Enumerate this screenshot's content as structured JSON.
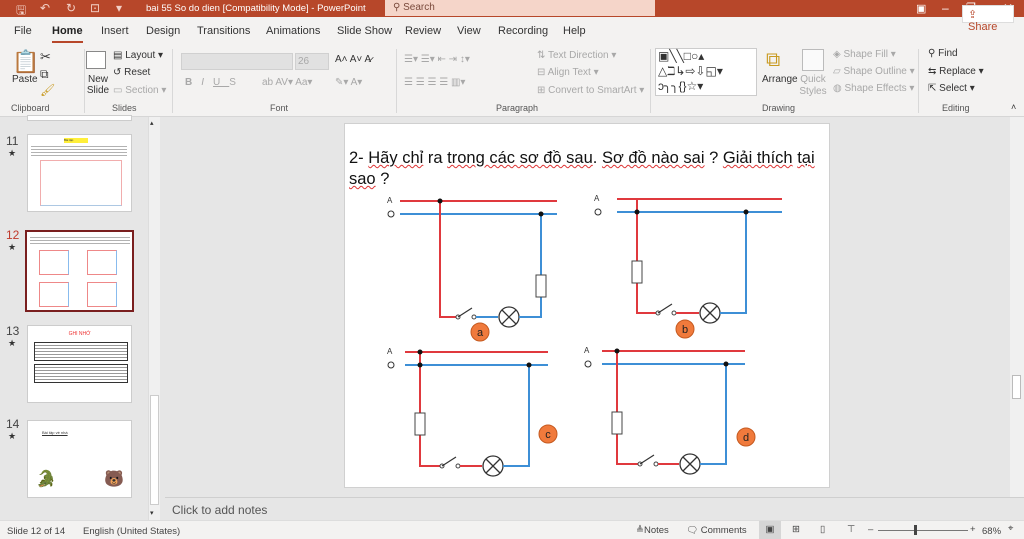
{
  "titlebar": {
    "doc_title": "bai 55 So do dien [Compatibility Mode]  -  PowerPoint",
    "search_placeholder": "Search",
    "accent": "#b7472a"
  },
  "tabs": [
    {
      "label": "File"
    },
    {
      "label": "Home",
      "active": true
    },
    {
      "label": "Insert"
    },
    {
      "label": "Design"
    },
    {
      "label": "Transitions"
    },
    {
      "label": "Animations"
    },
    {
      "label": "Slide Show"
    },
    {
      "label": "Review"
    },
    {
      "label": "View"
    },
    {
      "label": "Recording"
    },
    {
      "label": "Help"
    }
  ],
  "share_label": "Share",
  "ribbon": {
    "clipboard": {
      "paste": "Paste",
      "group": "Clipboard"
    },
    "slides": {
      "new_slide": "New Slide",
      "layout": "Layout",
      "reset": "Reset",
      "section": "Section",
      "group": "Slides"
    },
    "font": {
      "font_size": "26",
      "bold": "B",
      "italic": "I",
      "underline": "U",
      "strike": "S",
      "group": "Font"
    },
    "paragraph": {
      "text_direction": "Text Direction",
      "align_text": "Align Text",
      "convert": "Convert to SmartArt",
      "group": "Paragraph"
    },
    "drawing": {
      "arrange": "Arrange",
      "quick_styles": "Quick Styles",
      "shape_fill": "Shape Fill",
      "shape_outline": "Shape Outline",
      "shape_effects": "Shape Effects",
      "group": "Drawing"
    },
    "editing": {
      "find": "Find",
      "replace": "Replace",
      "select": "Select",
      "group": "Editing"
    }
  },
  "thumbnails": [
    {
      "number": "11",
      "title": "Bài tập"
    },
    {
      "number": "12",
      "selected": true
    },
    {
      "number": "13",
      "title": "GHI NHỚ"
    },
    {
      "number": "14",
      "title": "Bài tập về nhà"
    }
  ],
  "slide": {
    "title_parts": [
      "2- ",
      "Hãy chỉ",
      " ra ",
      "trong các sơ đồ sau",
      ". ",
      "Sơ đồ nào sai",
      " ? ",
      "Giải thích",
      " ",
      "tại sao",
      " ?"
    ],
    "phase_label": "A",
    "neutral_label": "O",
    "diagram_labels": [
      "a",
      "b",
      "c",
      "d"
    ],
    "colors": {
      "phase": "#e0393e",
      "neutral": "#3d8fd6",
      "label_fill": "#f07a3c"
    }
  },
  "notes_placeholder": "Click to add notes",
  "status": {
    "slide_info": "Slide 12 of 14",
    "language": "English (United States)",
    "notes": "Notes",
    "comments": "Comments",
    "zoom": "68%",
    "zoom_percent": 68
  }
}
